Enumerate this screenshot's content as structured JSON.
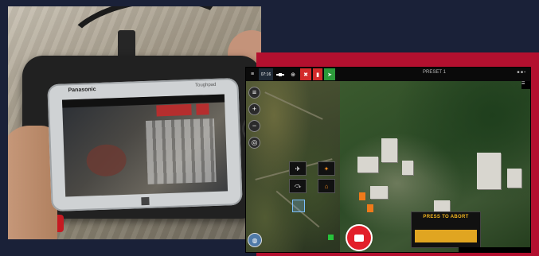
{
  "photo": {
    "brand": "Panasonic",
    "brand_model": "Toughpad"
  },
  "colors": {
    "background": "#1a2138",
    "accent_red": "#b3102f",
    "alert_red": "#d32b2b",
    "gps_green": "#2c9a3a",
    "abort_yellow": "#e0a521"
  },
  "toolbar": {
    "menu_icon": "≡",
    "speed_readout": "07:16",
    "satellite_icon": "satellite-icon",
    "zoom_icon": "⊕",
    "alert_icon": "✖",
    "battery_icon": "▮",
    "gps_icon": "➤",
    "title": "PRESET 1",
    "status_right": "■ ■ ▪"
  },
  "map_tools": [
    "≡",
    "+",
    "−",
    "◎"
  ],
  "controls": {
    "drone_up": "✈",
    "drone_up_alt": "✦",
    "rotate": "⤼",
    "landing": "⌂"
  },
  "abort": {
    "label": "PRESS TO ABORT"
  },
  "globe_icon": "◍",
  "right_panel_icon": "☰"
}
